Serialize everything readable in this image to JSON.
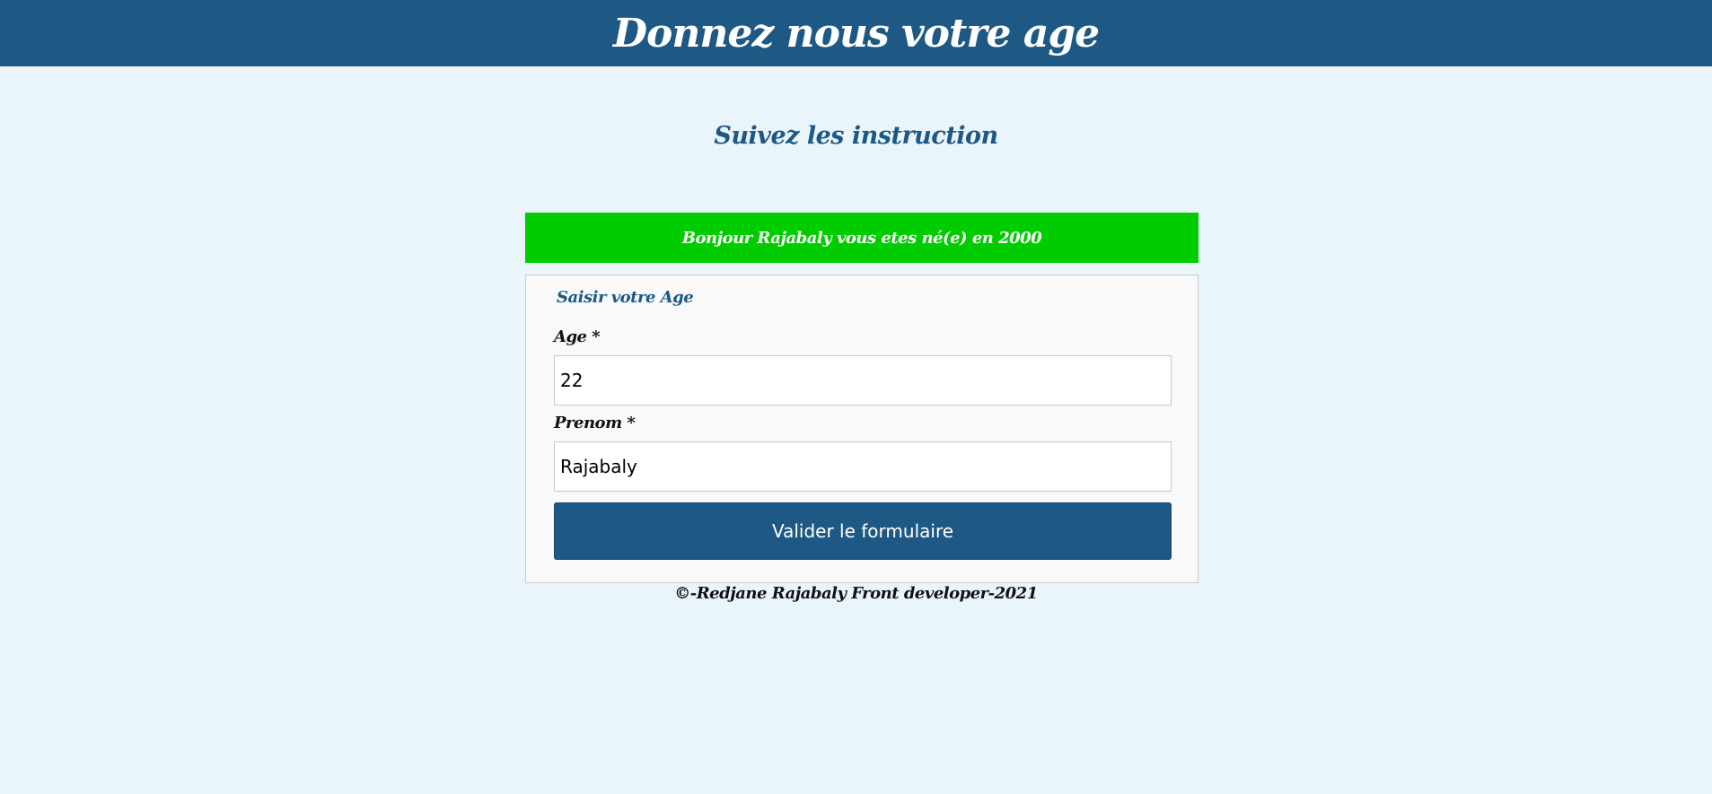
{
  "header": {
    "title": "Donnez nous votre age"
  },
  "subtitle": "Suivez les instruction",
  "alert": {
    "message": "Bonjour Rajabaly vous etes né(e) en 2000"
  },
  "form": {
    "legend": "Saisir votre Age",
    "age": {
      "label": "Age *",
      "value": "22"
    },
    "prenom": {
      "label": "Prenom *",
      "value": "Rajabaly"
    },
    "submit_label": "Valider le formulaire"
  },
  "footer": {
    "text": "©-Redjane Rajabaly Front developer-2021"
  },
  "colors": {
    "header_bg": "#1d5984",
    "page_bg": "#eaf4fb",
    "alert_bg": "#00cc00",
    "button_bg": "#1d5984"
  }
}
